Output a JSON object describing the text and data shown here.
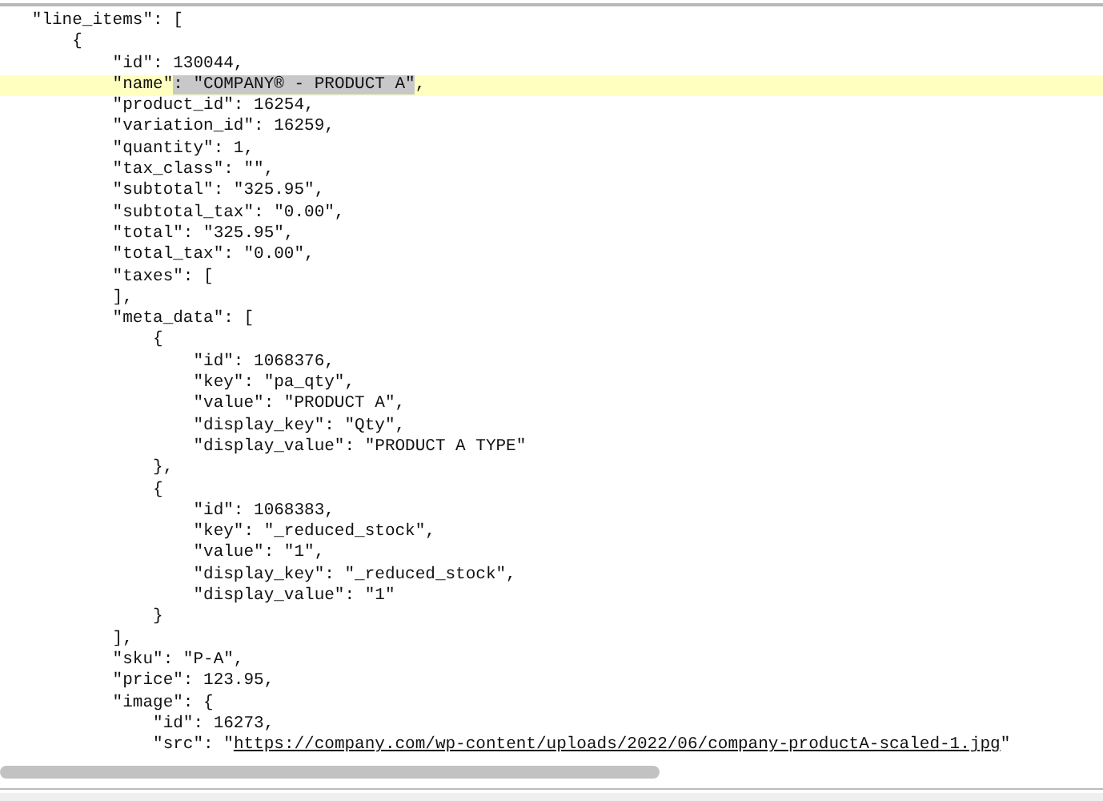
{
  "code_lines": [
    {
      "highlighted": false,
      "segments": [
        {
          "kind": "plain",
          "text": "   \"line_items\": ["
        }
      ]
    },
    {
      "highlighted": false,
      "segments": [
        {
          "kind": "plain",
          "text": "       {"
        }
      ]
    },
    {
      "highlighted": false,
      "segments": [
        {
          "kind": "plain",
          "text": "           \"id\": 130044,"
        }
      ]
    },
    {
      "highlighted": true,
      "segments": [
        {
          "kind": "plain",
          "text": "           \"name\""
        },
        {
          "kind": "selection",
          "text": ": \"COMPANY® - PRODUCT A\""
        },
        {
          "kind": "plain",
          "text": ","
        }
      ]
    },
    {
      "highlighted": false,
      "segments": [
        {
          "kind": "plain",
          "text": "           \"product_id\": 16254,"
        }
      ]
    },
    {
      "highlighted": false,
      "segments": [
        {
          "kind": "plain",
          "text": "           \"variation_id\": 16259,"
        }
      ]
    },
    {
      "highlighted": false,
      "segments": [
        {
          "kind": "plain",
          "text": "           \"quantity\": 1,"
        }
      ]
    },
    {
      "highlighted": false,
      "segments": [
        {
          "kind": "plain",
          "text": "           \"tax_class\": \"\","
        }
      ]
    },
    {
      "highlighted": false,
      "segments": [
        {
          "kind": "plain",
          "text": "           \"subtotal\": \"325.95\","
        }
      ]
    },
    {
      "highlighted": false,
      "segments": [
        {
          "kind": "plain",
          "text": "           \"subtotal_tax\": \"0.00\","
        }
      ]
    },
    {
      "highlighted": false,
      "segments": [
        {
          "kind": "plain",
          "text": "           \"total\": \"325.95\","
        }
      ]
    },
    {
      "highlighted": false,
      "segments": [
        {
          "kind": "plain",
          "text": "           \"total_tax\": \"0.00\","
        }
      ]
    },
    {
      "highlighted": false,
      "segments": [
        {
          "kind": "plain",
          "text": "           \"taxes\": ["
        }
      ]
    },
    {
      "highlighted": false,
      "segments": [
        {
          "kind": "plain",
          "text": "           ],"
        }
      ]
    },
    {
      "highlighted": false,
      "segments": [
        {
          "kind": "plain",
          "text": "           \"meta_data\": ["
        }
      ]
    },
    {
      "highlighted": false,
      "segments": [
        {
          "kind": "plain",
          "text": "               {"
        }
      ]
    },
    {
      "highlighted": false,
      "segments": [
        {
          "kind": "plain",
          "text": "                   \"id\": 1068376,"
        }
      ]
    },
    {
      "highlighted": false,
      "segments": [
        {
          "kind": "plain",
          "text": "                   \"key\": \"pa_qty\","
        }
      ]
    },
    {
      "highlighted": false,
      "segments": [
        {
          "kind": "plain",
          "text": "                   \"value\": \"PRODUCT A\","
        }
      ]
    },
    {
      "highlighted": false,
      "segments": [
        {
          "kind": "plain",
          "text": "                   \"display_key\": \"Qty\","
        }
      ]
    },
    {
      "highlighted": false,
      "segments": [
        {
          "kind": "plain",
          "text": "                   \"display_value\": \"PRODUCT A TYPE\""
        }
      ]
    },
    {
      "highlighted": false,
      "segments": [
        {
          "kind": "plain",
          "text": "               },"
        }
      ]
    },
    {
      "highlighted": false,
      "segments": [
        {
          "kind": "plain",
          "text": "               {"
        }
      ]
    },
    {
      "highlighted": false,
      "segments": [
        {
          "kind": "plain",
          "text": "                   \"id\": 1068383,"
        }
      ]
    },
    {
      "highlighted": false,
      "segments": [
        {
          "kind": "plain",
          "text": "                   \"key\": \"_reduced_stock\","
        }
      ]
    },
    {
      "highlighted": false,
      "segments": [
        {
          "kind": "plain",
          "text": "                   \"value\": \"1\","
        }
      ]
    },
    {
      "highlighted": false,
      "segments": [
        {
          "kind": "plain",
          "text": "                   \"display_key\": \"_reduced_stock\","
        }
      ]
    },
    {
      "highlighted": false,
      "segments": [
        {
          "kind": "plain",
          "text": "                   \"display_value\": \"1\""
        }
      ]
    },
    {
      "highlighted": false,
      "segments": [
        {
          "kind": "plain",
          "text": "               }"
        }
      ]
    },
    {
      "highlighted": false,
      "segments": [
        {
          "kind": "plain",
          "text": "           ],"
        }
      ]
    },
    {
      "highlighted": false,
      "segments": [
        {
          "kind": "plain",
          "text": "           \"sku\": \"P-A\","
        }
      ]
    },
    {
      "highlighted": false,
      "segments": [
        {
          "kind": "plain",
          "text": "           \"price\": 123.95,"
        }
      ]
    },
    {
      "highlighted": false,
      "segments": [
        {
          "kind": "plain",
          "text": "           \"image\": {"
        }
      ]
    },
    {
      "highlighted": false,
      "segments": [
        {
          "kind": "plain",
          "text": "               \"id\": 16273,"
        }
      ]
    },
    {
      "highlighted": false,
      "segments": [
        {
          "kind": "plain",
          "text": "               \"src\": \""
        },
        {
          "kind": "link",
          "text": "https://company.com/wp-content/uploads/2022/06/company-productA-scaled-1.jpg"
        },
        {
          "kind": "plain",
          "text": "\""
        }
      ]
    }
  ]
}
